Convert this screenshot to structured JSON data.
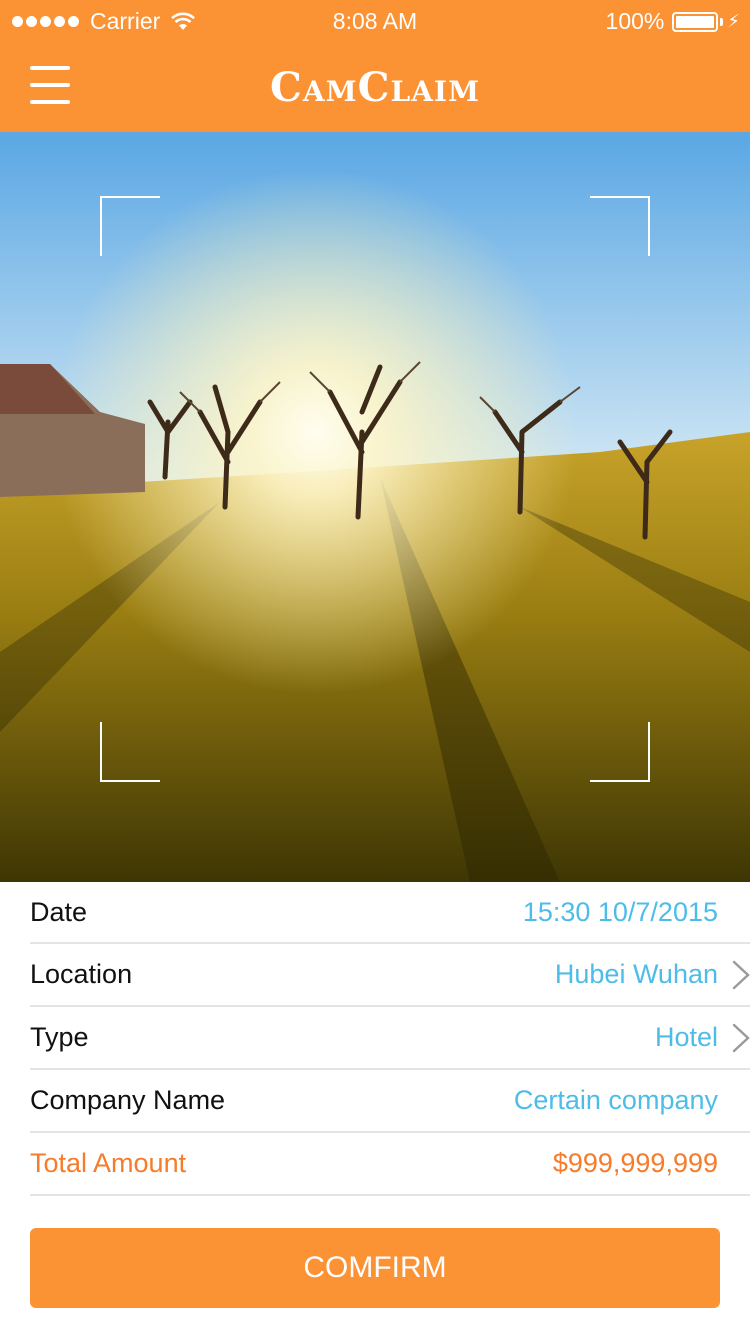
{
  "status_bar": {
    "carrier": "Carrier",
    "time": "8:08 AM",
    "battery": "100%"
  },
  "header": {
    "title": "CamClaim",
    "menu_icon": "hamburger-menu-icon",
    "background_color": "#fb9234"
  },
  "photo": {
    "description_icon": "camera-viewfinder"
  },
  "form": {
    "rows": [
      {
        "label": "Date",
        "value": "15:30 10/7/2015",
        "has_chevron": false
      },
      {
        "label": "Location",
        "value": "Hubei Wuhan",
        "has_chevron": true
      },
      {
        "label": "Type",
        "value": "Hotel",
        "has_chevron": true
      },
      {
        "label": "Company Name",
        "value": "Certain company",
        "has_chevron": false
      }
    ],
    "total": {
      "label": "Total Amount",
      "value": "$999,999,999"
    }
  },
  "confirm_label": "COMFIRM",
  "colors": {
    "accent": "#fb9234",
    "value_blue": "#4dbde8",
    "total_orange": "#f67b2a"
  }
}
